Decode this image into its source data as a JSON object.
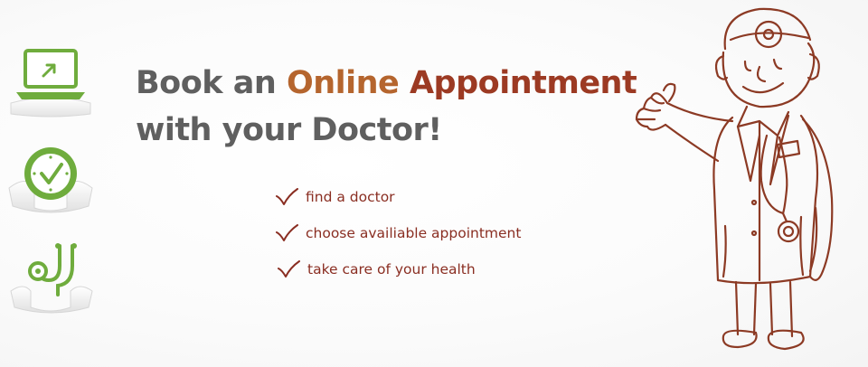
{
  "banner": {
    "headline": {
      "part1": "Book an ",
      "part2": "Online",
      "part3": " ",
      "part4": "Appointment",
      "line2": "with your Doctor!"
    },
    "steps": [
      {
        "label": "find a doctor",
        "icon": "check-icon"
      },
      {
        "label": "choose availiable appointment",
        "icon": "check-icon"
      },
      {
        "label": "take care of your health",
        "icon": "check-icon"
      }
    ],
    "side_icons": [
      "laptop-icon",
      "clock-icon",
      "stethoscope-icon"
    ],
    "illustration": "doctor-illustration"
  },
  "colors": {
    "headline_gray": "#5f5f5f",
    "accent_orange": "#b5652e",
    "accent_red": "#9c3a23",
    "list_text": "#8a2e22",
    "icon_green": "#6fac3d",
    "sketch_brown": "#8c3a24"
  }
}
